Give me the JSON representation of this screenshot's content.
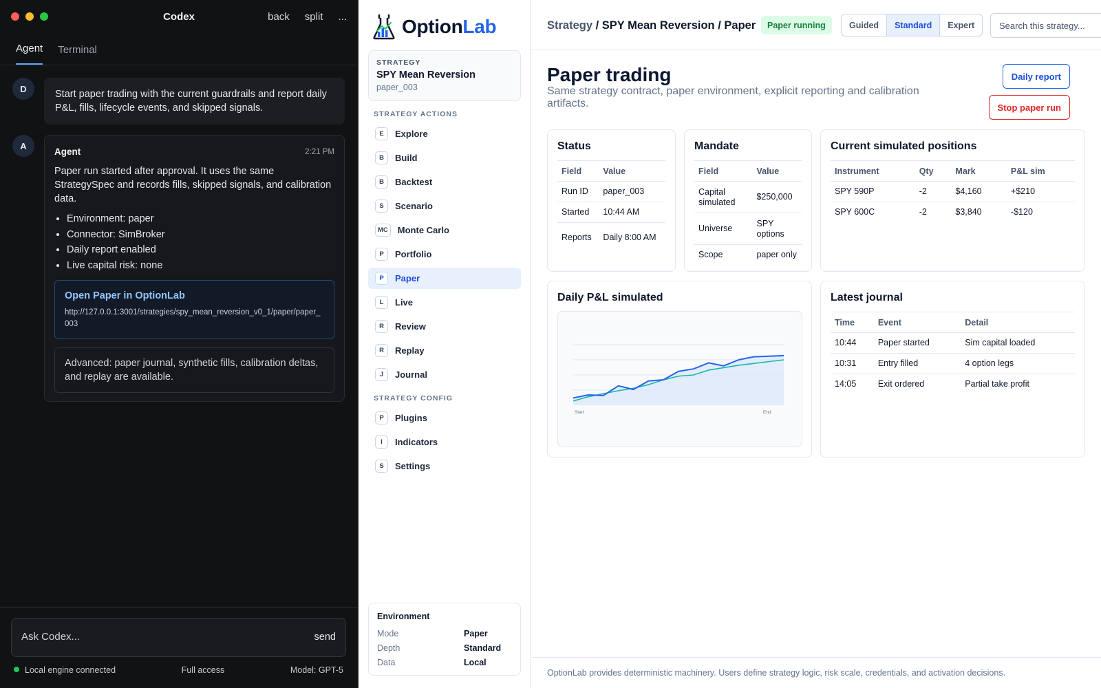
{
  "codex": {
    "window_title": "Codex",
    "title_actions": [
      "back",
      "split",
      "..."
    ],
    "tabs": [
      {
        "label": "Agent"
      },
      {
        "label": "Terminal"
      }
    ],
    "user_message": {
      "avatar": "D",
      "text": "Start paper trading with the current guardrails and report daily P&L, fills, lifecycle events, and skipped signals."
    },
    "agent_message": {
      "avatar": "A",
      "name": "Agent",
      "time": "2:21 PM",
      "text": "Paper run started after approval. It uses the same StrategySpec and records fills, skipped signals, and calibration data.",
      "bullets": [
        "Environment: paper",
        "Connector: SimBroker",
        "Daily report enabled",
        "Live capital risk: none"
      ],
      "link_title": "Open Paper in OptionLab",
      "link_url": "http://127.0.0.1:3001/strategies/spy_mean_reversion_v0_1/paper/paper_003",
      "advanced": "Advanced: paper journal, synthetic fills, calibration deltas, and replay are available."
    },
    "composer": {
      "placeholder": "Ask Codex...",
      "send_label": "send"
    },
    "status": {
      "engine": "Local engine connected",
      "access": "Full access",
      "model": "Model: GPT-5"
    }
  },
  "sidebar": {
    "brand_part1": "Option",
    "brand_part2": "Lab",
    "strategy_label": "STRATEGY",
    "strategy_name": "SPY Mean Reversion",
    "strategy_id": "paper_003",
    "actions_header": "STRATEGY ACTIONS",
    "actions": [
      {
        "badge": "E",
        "label": "Explore"
      },
      {
        "badge": "B",
        "label": "Build"
      },
      {
        "badge": "B",
        "label": "Backtest"
      },
      {
        "badge": "S",
        "label": "Scenario"
      },
      {
        "badge": "MC",
        "label": "Monte Carlo"
      },
      {
        "badge": "P",
        "label": "Portfolio"
      },
      {
        "badge": "P",
        "label": "Paper"
      },
      {
        "badge": "L",
        "label": "Live"
      },
      {
        "badge": "R",
        "label": "Review"
      },
      {
        "badge": "R",
        "label": "Replay"
      },
      {
        "badge": "J",
        "label": "Journal"
      }
    ],
    "config_header": "STRATEGY CONFIG",
    "config": [
      {
        "badge": "P",
        "label": "Plugins"
      },
      {
        "badge": "I",
        "label": "Indicators"
      },
      {
        "badge": "S",
        "label": "Settings"
      }
    ],
    "environment": {
      "title": "Environment",
      "rows": [
        {
          "key": "Mode",
          "value": "Paper"
        },
        {
          "key": "Depth",
          "value": "Standard"
        },
        {
          "key": "Data",
          "value": "Local"
        }
      ]
    }
  },
  "main": {
    "breadcrumb_root": "Strategy",
    "breadcrumb_rest": " / SPY Mean Reversion / Paper",
    "status_pill": "Paper running",
    "modes": [
      "Guided",
      "Standard",
      "Expert"
    ],
    "search_placeholder": "Search this strategy...",
    "title": "Paper trading",
    "subtitle": "Same strategy contract, paper environment, explicit reporting and calibration artifacts.",
    "daily_report_label": "Daily report",
    "stop_label": "Stop paper run",
    "status_card": {
      "title": "Status",
      "headers": [
        "Field",
        "Value"
      ],
      "rows": [
        [
          "Run ID",
          "paper_003"
        ],
        [
          "Started",
          "10:44 AM"
        ],
        [
          "Reports",
          "Daily 8:00 AM"
        ]
      ]
    },
    "mandate_card": {
      "title": "Mandate",
      "headers": [
        "Field",
        "Value"
      ],
      "rows": [
        [
          "Capital simulated",
          "$250,000"
        ],
        [
          "Universe",
          "SPY options"
        ],
        [
          "Scope",
          "paper only"
        ]
      ]
    },
    "positions_card": {
      "title": "Current simulated positions",
      "headers": [
        "Instrument",
        "Qty",
        "Mark",
        "P&L sim"
      ],
      "rows": [
        [
          "SPY 590P",
          "-2",
          "$4,160",
          "+$210"
        ],
        [
          "SPY 600C",
          "-2",
          "$3,840",
          "-$120"
        ]
      ]
    },
    "chart_card": {
      "title": "Daily P&L simulated"
    },
    "journal_card": {
      "title": "Latest journal",
      "headers": [
        "Time",
        "Event",
        "Detail"
      ],
      "rows": [
        [
          "10:44",
          "Paper started",
          "Sim capital loaded"
        ],
        [
          "10:31",
          "Entry filled",
          "4 option legs"
        ],
        [
          "14:05",
          "Exit ordered",
          "Partial take profit"
        ]
      ]
    },
    "footer": "OptionLab provides deterministic machinery. Users define strategy logic, risk scale, credentials, and activation decisions."
  },
  "colors": {
    "accent": "#2563eb",
    "positive": "#16a34a",
    "negative": "#dc2626",
    "running_pill_bg": "#dcfce7",
    "series_primary": "#2563eb",
    "series_secondary": "#14b8a6"
  },
  "chart_data": {
    "type": "line",
    "title": "Daily P&L simulated",
    "x_tick_labels": [
      "Start",
      "End"
    ],
    "x": [
      0,
      1,
      2,
      3,
      4,
      5,
      6,
      7,
      8,
      9,
      10,
      11,
      12,
      13,
      14
    ],
    "grid": true,
    "area_under_primary": true,
    "ylim": [
      0,
      100
    ],
    "series": [
      {
        "values": [
          12,
          17,
          16,
          32,
          26,
          40,
          42,
          56,
          60,
          70,
          65,
          75,
          80,
          81,
          82
        ]
      },
      {
        "values": [
          7,
          14,
          19,
          24,
          28,
          34,
          42,
          48,
          50,
          58,
          62,
          66,
          69,
          72,
          75
        ]
      }
    ]
  }
}
